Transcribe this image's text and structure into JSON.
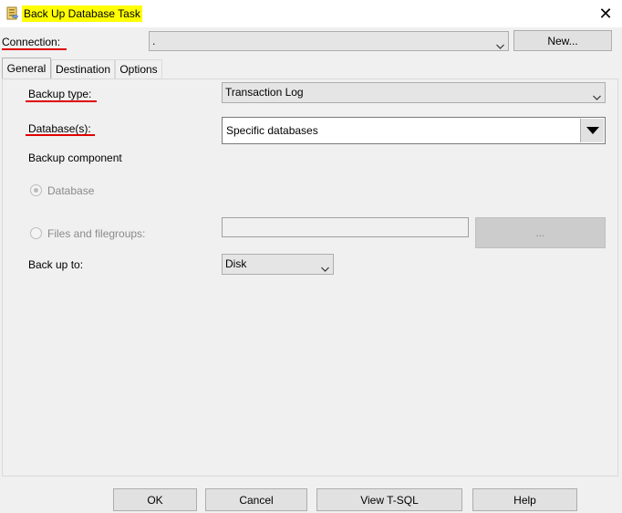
{
  "window": {
    "title": "Back Up Database Task",
    "close_glyph": "✕"
  },
  "connection": {
    "label": "Connection:",
    "value": ".",
    "new_button": "New..."
  },
  "tabs": [
    {
      "label": "General",
      "active": true
    },
    {
      "label": "Destination",
      "active": false
    },
    {
      "label": "Options",
      "active": false
    }
  ],
  "general": {
    "backup_type_label": "Backup type:",
    "backup_type_value": "Transaction Log",
    "databases_label": "Database(s):",
    "databases_value": "Specific databases",
    "backup_component_label": "Backup component",
    "radio_database_label": "Database",
    "radio_files_label": "Files and filegroups:",
    "files_value": "",
    "browse_button": "...",
    "back_up_to_label": "Back up to:",
    "back_up_to_value": "Disk"
  },
  "footer": {
    "ok": "OK",
    "cancel": "Cancel",
    "view_tsql": "View T-SQL",
    "help": "Help"
  },
  "colors": {
    "title_highlight": "#ffff00",
    "annotation_underline": "#e00000",
    "dialog_background": "#f0f0f0"
  },
  "icons": [
    "database-task-icon",
    "close-icon",
    "chevron-down-icon",
    "dropdown-arrow-icon"
  ]
}
